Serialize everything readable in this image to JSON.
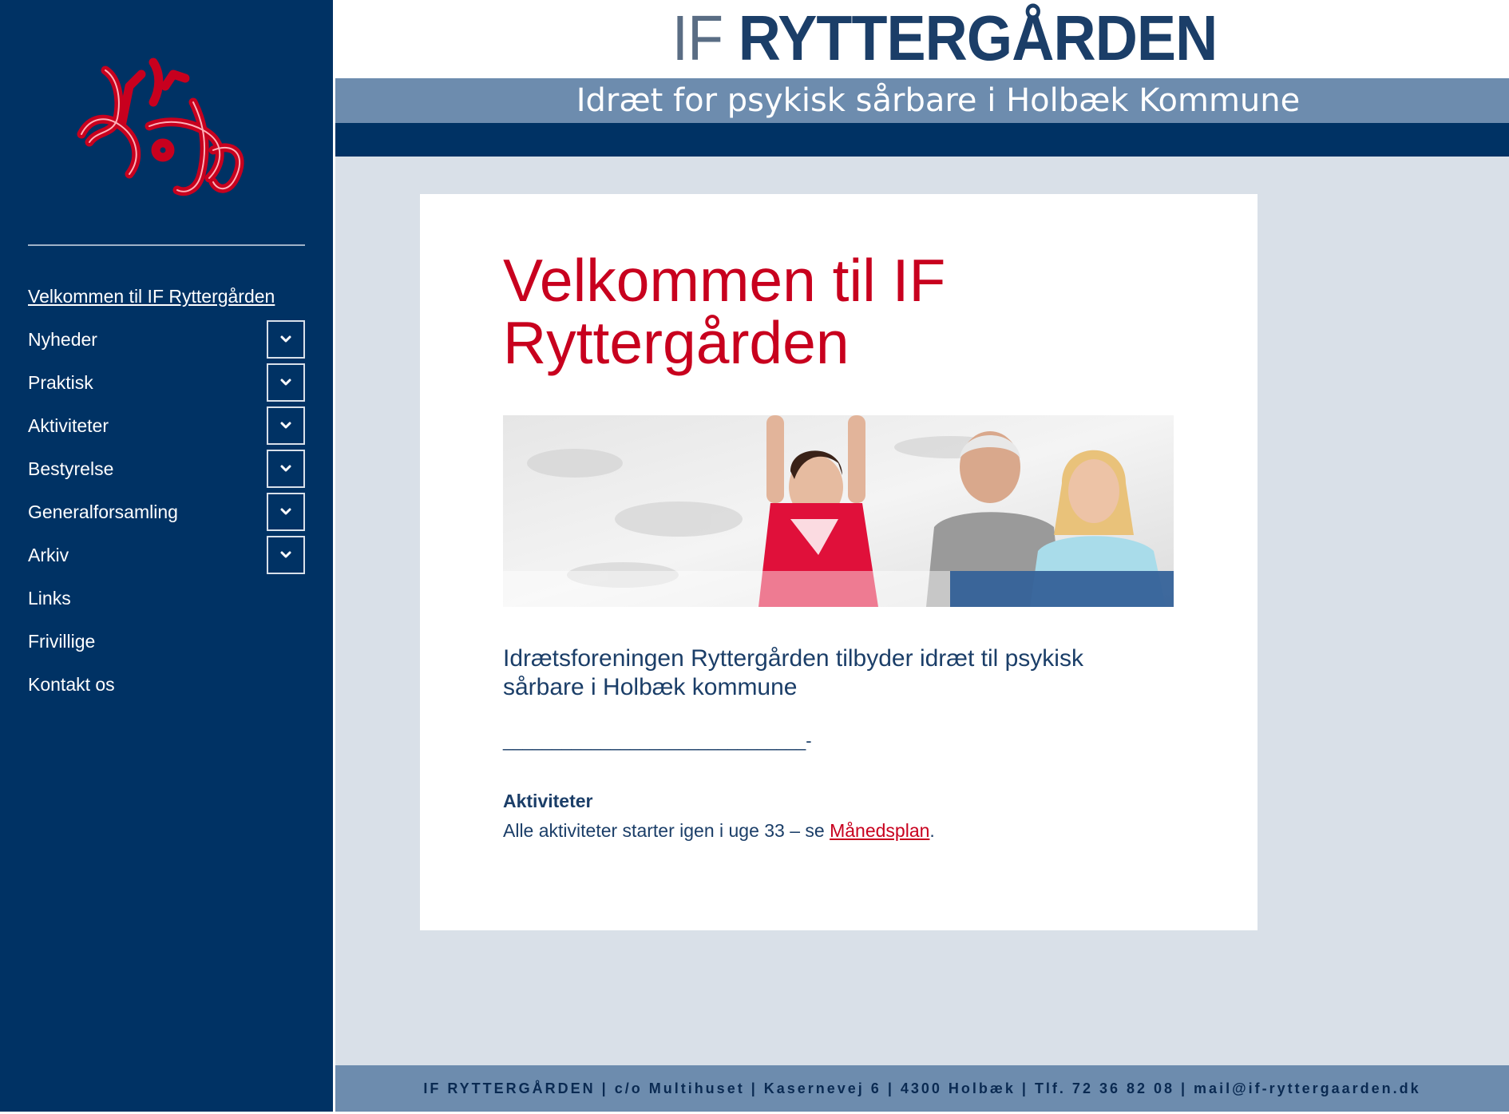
{
  "header": {
    "title_prefix": "IF",
    "title_main": "RYTTERGÅRDEN",
    "tagline": "Idræt for psykisk sårbare i Holbæk Kommune"
  },
  "sidebar": {
    "items": [
      {
        "label": "Velkommen til IF Ryttergården",
        "has_submenu": false,
        "active": true
      },
      {
        "label": "Nyheder",
        "has_submenu": true
      },
      {
        "label": "Praktisk",
        "has_submenu": true
      },
      {
        "label": "Aktiviteter",
        "has_submenu": true
      },
      {
        "label": "Bestyrelse",
        "has_submenu": true
      },
      {
        "label": "Generalforsamling",
        "has_submenu": true
      },
      {
        "label": "Arkiv",
        "has_submenu": true
      },
      {
        "label": "Links",
        "has_submenu": false
      },
      {
        "label": "Frivillige",
        "has_submenu": false
      },
      {
        "label": "Kontakt os",
        "has_submenu": false
      }
    ]
  },
  "main": {
    "title": "Velkommen til IF Ryttergården",
    "intro": "Idrætsforeningen Ryttergården tilbyder idræt til psykisk sårbare i Holbæk kommune",
    "rule": "_______________________________-",
    "section_heading": "Aktiviteter",
    "section_text_before": "Alle aktiviteter starter igen i uge 33 – se ",
    "section_link": "Månedsplan",
    "section_text_after": "."
  },
  "footer": {
    "text": "IF RYTTERGÅRDEN | c/o Multihuset | Kasernevej 6 | 4300 Holbæk | Tlf. 72 36 82 08 | mail@if-ryttergaarden.dk"
  },
  "colors": {
    "navy": "#003264",
    "steel_blue": "#6d8cae",
    "accent_red": "#c8001e",
    "page_bg": "#d9e0e8",
    "text_blue": "#1b3e68"
  },
  "icons": {
    "submenu": "chevron-down-icon",
    "logo": "club-logo"
  }
}
